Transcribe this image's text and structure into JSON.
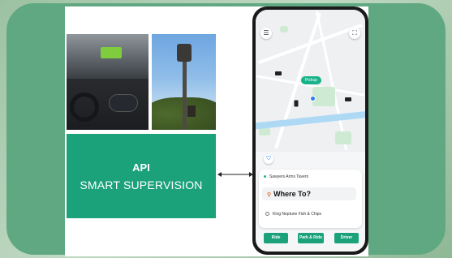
{
  "api_box": {
    "title": "API",
    "subtitle": "SMART SUPERVISION"
  },
  "phone": {
    "map": {
      "pickup_label": "Pickup"
    },
    "sheet": {
      "origin": "Sawyers Arms Tavern",
      "where_to": "Where To?",
      "recent": "King Neptune Fish & Chips"
    },
    "actions": [
      "Ride",
      "Park & Ride",
      "Driver"
    ]
  },
  "colors": {
    "brand_green": "#1ba27a",
    "frame_green": "#60a882"
  },
  "icons": {
    "menu": "hamburger-menu-icon",
    "scan": "scan-icon",
    "shield": "shield-icon",
    "search": "search-icon",
    "recent": "clock-icon"
  }
}
